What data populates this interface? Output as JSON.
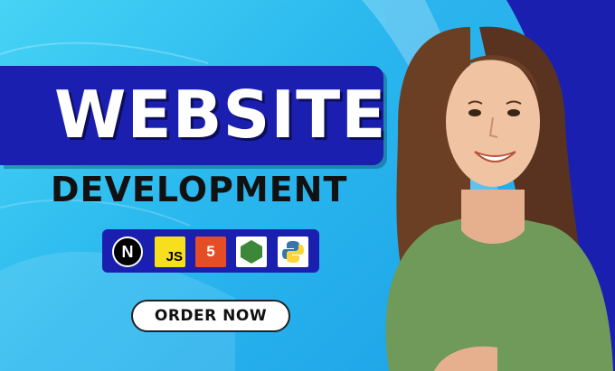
{
  "headline": "WEBSITE",
  "subheadline": "DEVELOPMENT",
  "cta": "ORDER NOW",
  "tech_icons": [
    {
      "name": "nextjs-icon",
      "label": "N"
    },
    {
      "name": "javascript-icon",
      "label": "JS"
    },
    {
      "name": "html5-icon",
      "label": "5"
    },
    {
      "name": "nodejs-icon",
      "label": ""
    },
    {
      "name": "python-icon",
      "label": ""
    }
  ],
  "colors": {
    "background": "#2ab8ee",
    "title_box": "#1b1fb0",
    "js_yellow": "#f7df1e",
    "html_orange": "#e44d26",
    "node_green": "#3c873a",
    "python_blue": "#3776ab",
    "python_yellow": "#ffd43b",
    "shirt": "#6f9a5a"
  }
}
